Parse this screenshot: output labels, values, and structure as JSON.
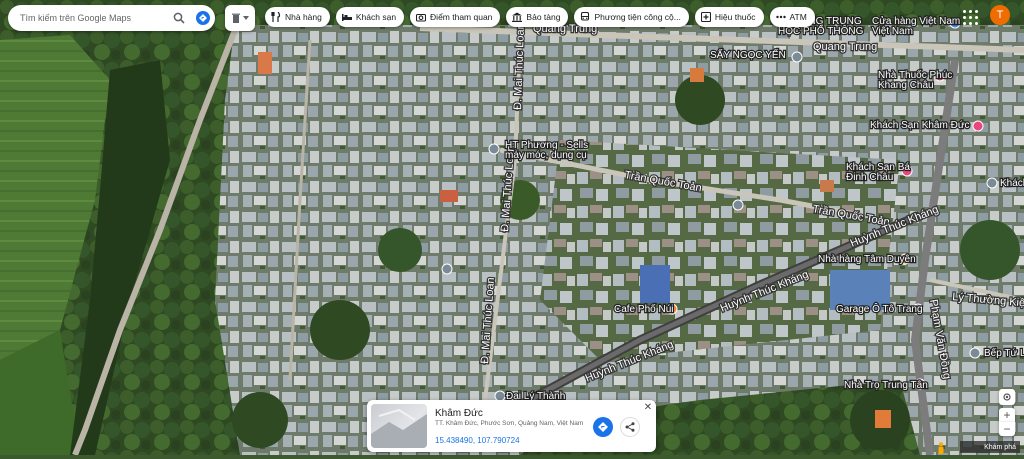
{
  "search": {
    "placeholder": "Tìm kiếm trên Google Maps"
  },
  "chips": [
    {
      "label": "Nhà hàng",
      "icon": "fork-knife-icon"
    },
    {
      "label": "Khách sạn",
      "icon": "bed-icon"
    },
    {
      "label": "Điểm tham quan",
      "icon": "camera-icon"
    },
    {
      "label": "Bảo tàng",
      "icon": "museum-icon"
    },
    {
      "label": "Phương tiện công cộ...",
      "icon": "transit-icon"
    },
    {
      "label": "Hiệu thuốc",
      "icon": "pharmacy-icon"
    },
    {
      "label": "ATM",
      "icon": "more-dots-icon"
    }
  ],
  "user": {
    "initial": "T"
  },
  "roads": {
    "quang_trung_1": "Quang Trung",
    "quang_trung_2": "Quang Trung",
    "tran_quoc_toan_1": "Trần Quốc Toản",
    "tran_quoc_toan_2": "Trần Quốc Toản",
    "huynh_thuc_khang_1": "Huỳnh Thúc Kháng",
    "huynh_thuc_khang_2": "Huỳnh Thúc Kháng",
    "huynh_thuc_khang_3": "Huỳnh Thúc Kháng",
    "mai_thuc_loan_1": "Đ. Mai Thúc Loan",
    "mai_thuc_loan_2": "Đ. Mai Thúc Loan",
    "mai_thuc_loan_3": "Đ. Mai Thúc Loan",
    "ly_thuong_kiet": "Lý Thường Kiệt",
    "pham_van_dong": "Phạm Văn Đồng"
  },
  "places": {
    "ht_phuong": "HT Phương - Sells",
    "ht_phuong_2": "máy móc, dụng cụ",
    "say_ngoc": "SẤY NGỌC YẾN",
    "truong_trung": "TRƯỜNG TRUNG",
    "truong_trung_2": "HỌC PHỔ THÔNG",
    "viet_nam": "Cửa hàng Việt Nam",
    "viet_nam_2": "Việt Nam",
    "nha_thuoc": "Nhà Thuốc Phúc",
    "nha_thuoc_2": "Khang Châu",
    "khach_san_1": "Khách Sạn Khâm Đức",
    "khach_san_2": "Khách Sạn Bá",
    "khach_san_2b": "Đinh Châu",
    "nha_hang_tam_duyen": "Nhà hàng Tâm Duyên",
    "cafe": "Cafe Phố Núi",
    "garage": "Garage Ô Tô Trang",
    "bo_tu_le": "Bếp Tứ Liêu",
    "nha_tro": "Nhà Trọ Trung Tân",
    "khach_san_3": "Khách San",
    "dai_ly": "Đại Lý Thành"
  },
  "card": {
    "title": "Khâm Đức",
    "address": "TT. Khâm Đức, Phước Sơn, Quảng Nam, Việt Nam",
    "coords": "15.438490, 107.790724"
  },
  "controls": {
    "explore_label": "Khám phá"
  }
}
